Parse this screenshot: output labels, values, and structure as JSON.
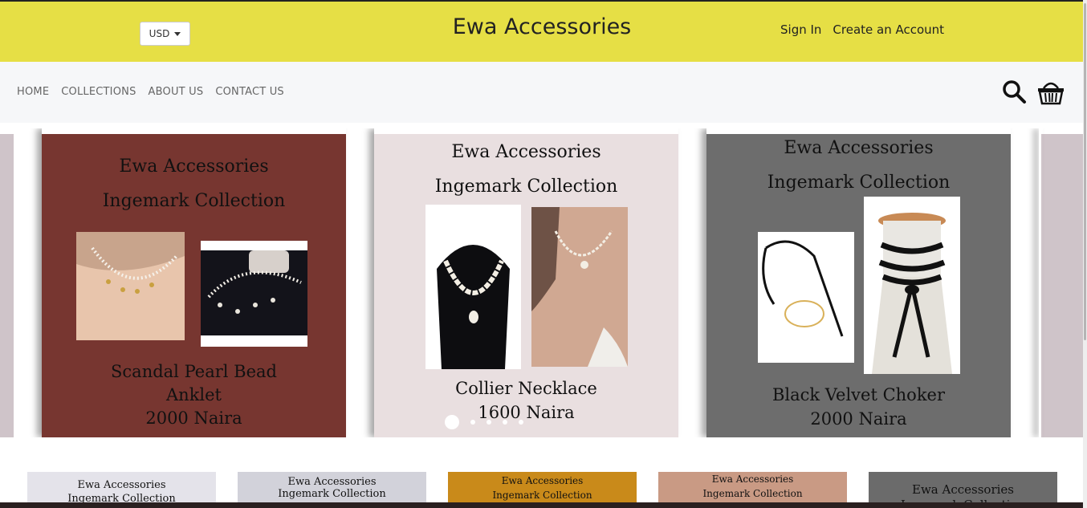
{
  "header": {
    "currency": "USD",
    "brand": "Ewa Accessories",
    "sign_in": "Sign In",
    "create_account": "Create an Account"
  },
  "nav": {
    "items": [
      "HOME",
      "COLLECTIONS",
      "ABOUT US",
      "CONTACT US"
    ]
  },
  "colors": {
    "header_bg": "#e6df45",
    "nav_bg": "#f6f7f9",
    "slide1_bg": "#773630",
    "slide2_bg": "#e9dfe0",
    "slide3_bg": "#6d6d6d"
  },
  "slides": [
    {
      "brand": "Ewa Accessories",
      "collection": "Ingemark Collection",
      "name_line1": "Scandal Pearl Bead",
      "name_line2": "Anklet",
      "price": "2000 Naira"
    },
    {
      "brand": "Ewa Accessories",
      "collection": "Ingemark Collection",
      "name_line1": "Collier Necklace",
      "price": "1600 Naira"
    },
    {
      "brand": "Ewa Accessories",
      "collection": "Ingemark Collection",
      "name_line1": "Black Velvet Choker",
      "price": "2000 Naira"
    }
  ],
  "slider_dots": {
    "count": 5,
    "active": 1
  },
  "thumbnails": [
    {
      "line1": "Ewa Accessories",
      "line2": "Ingemark Collection",
      "bg": "#e4e3ea"
    },
    {
      "line1": "Ewa Accessories",
      "line2": "Ingemark Collection",
      "bg": "#d2d2da"
    },
    {
      "line1": "Ewa Accessories",
      "line2": "Ingemark Collection",
      "bg": "#c98a1a"
    },
    {
      "line1": "Ewa Accessories",
      "line2": "Ingemark Collection",
      "bg": "#c99a84"
    },
    {
      "line1": "Ewa Accessories",
      "line2": "Ingemark Collection",
      "bg": "#6b6b6b"
    }
  ],
  "icons": {
    "search": "search-icon",
    "cart": "basket-icon",
    "currency_caret": "caret-down-icon"
  }
}
